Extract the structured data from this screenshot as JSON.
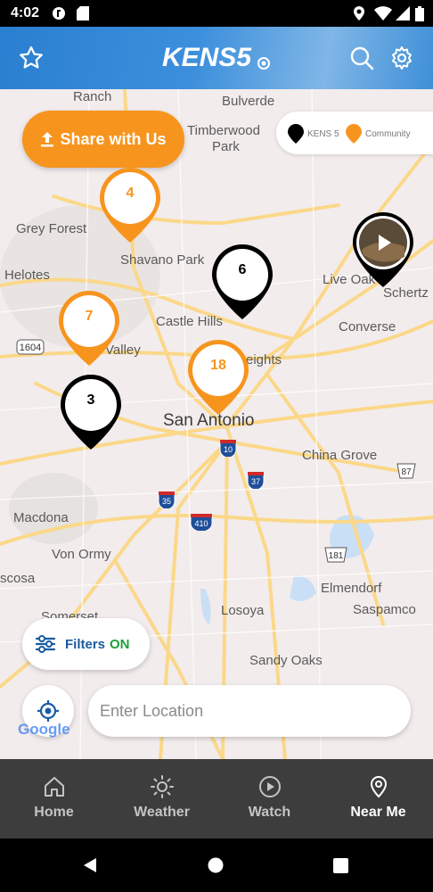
{
  "status_bar": {
    "time": "4:02"
  },
  "header": {
    "logo": "KENS5",
    "icons": [
      "star-icon",
      "search-icon",
      "gear-icon"
    ]
  },
  "map": {
    "share_label": "Share with Us",
    "legend": {
      "kens5": "KENS 5",
      "community": "Community"
    },
    "places": {
      "ranch": "Ranch",
      "bulverde": "Bulverde",
      "timberwood": "Timberwood",
      "park": "Park",
      "grey_forest": "Grey Forest",
      "shavano_park": "Shavano Park",
      "helotes": "Helotes",
      "live_oak": "Live Oak",
      "schertz": "Schertz",
      "castle_hills": "Castle Hills",
      "converse": "Converse",
      "valley": "Valley",
      "heights": "eights",
      "san_antonio": "San Antonio",
      "china_grove": "China Grove",
      "macdona": "Macdona",
      "von_ormy": "Von Ormy",
      "atascosa": "scosa",
      "elmendorf": "Elmendorf",
      "somerset": "Somerset",
      "losoya": "Losoya",
      "saspamco": "Saspamco",
      "sandy_oaks": "Sandy Oaks"
    },
    "road_labels": {
      "r1604": "1604",
      "r10": "10",
      "r37": "37",
      "r35": "35",
      "r410": "410",
      "r87": "87",
      "r181": "181"
    },
    "markers": [
      {
        "count": "4",
        "type": "community"
      },
      {
        "count": "6",
        "type": "kens5"
      },
      {
        "count": "7",
        "type": "community"
      },
      {
        "count": "18",
        "type": "community"
      },
      {
        "count": "3",
        "type": "kens5"
      },
      {
        "count": "",
        "type": "video"
      }
    ],
    "filters": {
      "label": "Filters",
      "state": "ON"
    },
    "location_placeholder": "Enter Location",
    "attribution": "Google"
  },
  "tabs": [
    {
      "label": "Home",
      "icon": "home-icon"
    },
    {
      "label": "Weather",
      "icon": "sun-icon"
    },
    {
      "label": "Watch",
      "icon": "play-circle-icon"
    },
    {
      "label": "Near Me",
      "icon": "location-pin-icon",
      "active": true
    }
  ],
  "colors": {
    "accent": "#f7941d",
    "header": "#2a7fd0",
    "filters_on": "#1e9e3a",
    "tabbar": "#3d3d3d"
  }
}
